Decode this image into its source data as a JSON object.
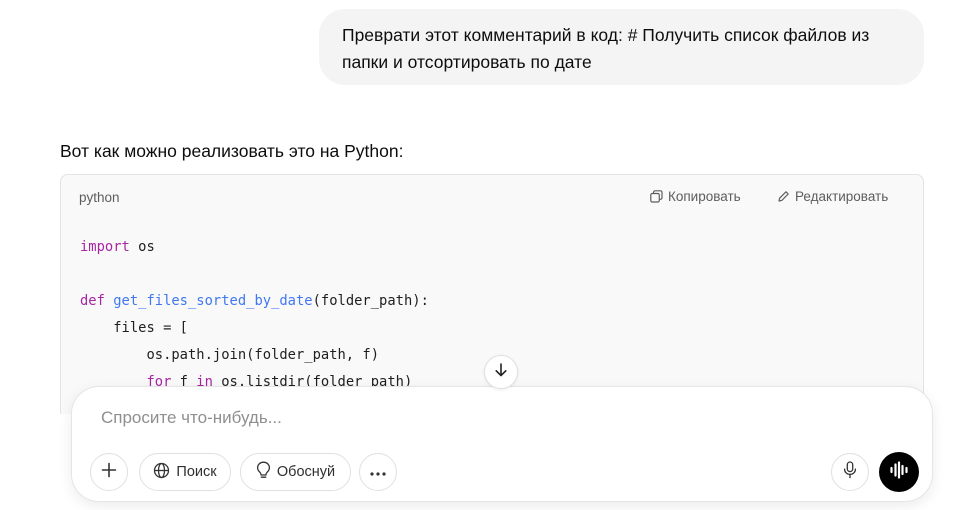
{
  "user_message": "Преврати этот комментарий в код: # Получить список файлов из папки и отсортировать по дате",
  "assistant": {
    "intro": "Вот как можно реализовать это на Python:",
    "code_block": {
      "language": "python",
      "copy_label": "Копировать",
      "edit_label": "Редактировать",
      "lines": {
        "l1_kw": "import",
        "l1_rest": " os",
        "l3_kw": "def",
        "l3_fn": "get_files_sorted_by_date",
        "l3_rest": "(folder_path):",
        "l4": "    files = [",
        "l5": "        os.path.join(folder_path, f)",
        "l6_indent": "        ",
        "l6_kw1": "for",
        "l6_mid": " f ",
        "l6_kw2": "in",
        "l6_rest": " os.listdir(folder_path)"
      }
    }
  },
  "composer": {
    "placeholder": "Спросите что-нибудь...",
    "search_label": "Поиск",
    "reason_label": "Обоснуй"
  },
  "icons": {
    "copy": "copy-icon",
    "edit": "pencil-icon",
    "scroll": "arrow-down-icon",
    "plus": "plus-icon",
    "globe": "globe-icon",
    "bulb": "lightbulb-icon",
    "more": "ellipsis-icon",
    "mic": "microphone-icon",
    "voice": "voice-waveform-icon"
  }
}
